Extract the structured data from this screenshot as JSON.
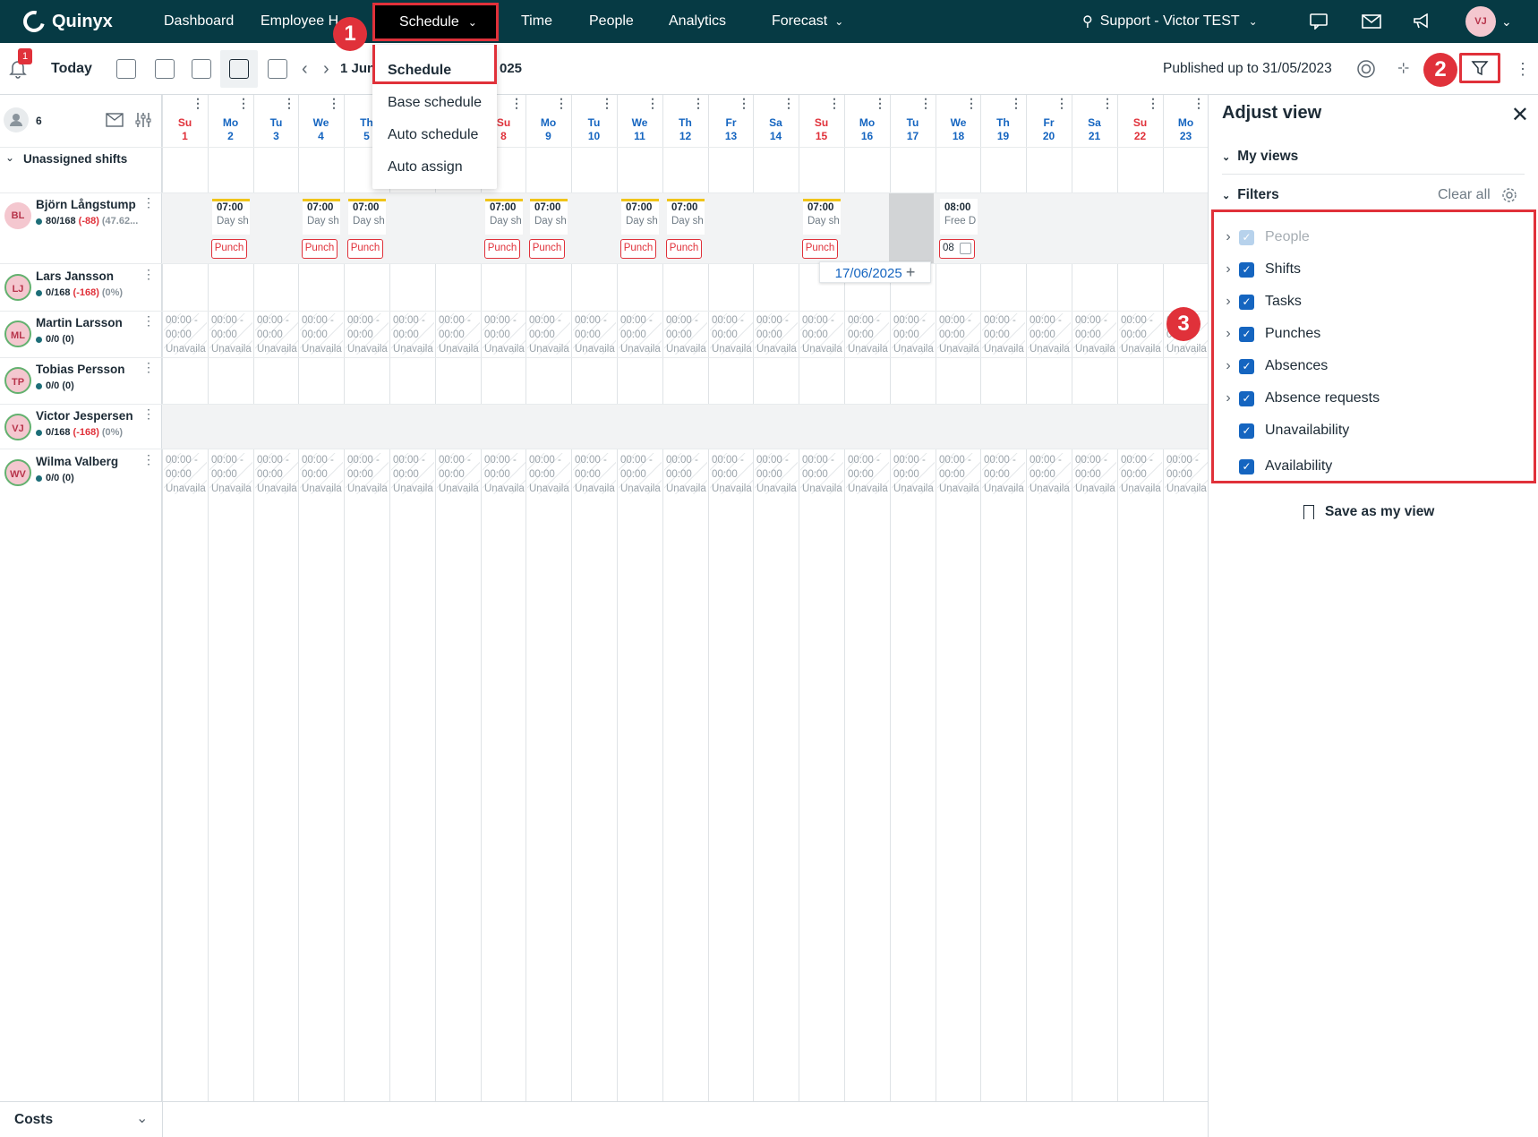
{
  "nav": {
    "brand": "Quinyx",
    "items": [
      "Dashboard",
      "Employee H",
      "Time",
      "People",
      "Analytics",
      "Forecast"
    ],
    "schedule": "Schedule",
    "unit": "Support - Victor TEST",
    "user_initials": "VJ"
  },
  "toolbar": {
    "notification_count": "1",
    "today": "Today",
    "date_range_prefix": "1 Jun",
    "date_range_suffix": "025",
    "published": "Published up to 31/05/2023"
  },
  "dropdown": [
    "Schedule",
    "Base schedule",
    "Auto schedule",
    "Auto assign"
  ],
  "callouts": [
    "1",
    "2",
    "3"
  ],
  "left": {
    "count": "6",
    "unassigned": "Unassigned shifts",
    "people": [
      {
        "initials": "BL",
        "name": "Björn Långstump",
        "stat": "80/168",
        "neg": "(-88)",
        "pct": "(47.62..."
      },
      {
        "initials": "LJ",
        "name": "Lars Jansson",
        "stat": "0/168",
        "neg": "(-168)",
        "pct": "(0%)"
      },
      {
        "initials": "ML",
        "name": "Martin Larsson",
        "stat": "0/0 (0)",
        "neg": "",
        "pct": ""
      },
      {
        "initials": "TP",
        "name": "Tobias Persson",
        "stat": "0/0 (0)",
        "neg": "",
        "pct": ""
      },
      {
        "initials": "VJ",
        "name": "Victor Jespersen",
        "stat": "0/168",
        "neg": "(-168)",
        "pct": "(0%)"
      },
      {
        "initials": "WV",
        "name": "Wilma Valberg",
        "stat": "0/0 (0)",
        "neg": "",
        "pct": ""
      }
    ]
  },
  "days": [
    {
      "d": "Su",
      "n": "1"
    },
    {
      "d": "Mo",
      "n": "2"
    },
    {
      "d": "Tu",
      "n": "3"
    },
    {
      "d": "We",
      "n": "4"
    },
    {
      "d": "Th",
      "n": "5"
    },
    {
      "d": "Fr",
      "n": "6"
    },
    {
      "d": "Sa",
      "n": "7"
    },
    {
      "d": "Su",
      "n": "8"
    },
    {
      "d": "Mo",
      "n": "9"
    },
    {
      "d": "Tu",
      "n": "10"
    },
    {
      "d": "We",
      "n": "11"
    },
    {
      "d": "Th",
      "n": "12"
    },
    {
      "d": "Fr",
      "n": "13"
    },
    {
      "d": "Sa",
      "n": "14"
    },
    {
      "d": "Su",
      "n": "15"
    },
    {
      "d": "Mo",
      "n": "16"
    },
    {
      "d": "Tu",
      "n": "17"
    },
    {
      "d": "We",
      "n": "18"
    },
    {
      "d": "Th",
      "n": "19"
    },
    {
      "d": "Fr",
      "n": "20"
    },
    {
      "d": "Sa",
      "n": "21"
    },
    {
      "d": "Su",
      "n": "22"
    },
    {
      "d": "Mo",
      "n": "23"
    }
  ],
  "shift": {
    "time": "07:00",
    "label": "Day sh",
    "punch": "Punch",
    "free_time": "08:00",
    "free_label": "Free D",
    "free_punch": "08"
  },
  "unavailable": {
    "line1": "00:00 -",
    "line2": "00:00",
    "line3": "Unavaila"
  },
  "date_badge": "17/06/2025",
  "panel": {
    "title": "Adjust view",
    "my_views": "My views",
    "filters": "Filters",
    "clear_all": "Clear all",
    "filter_items": [
      {
        "label": "People",
        "expandable": true,
        "disabled": true
      },
      {
        "label": "Shifts",
        "expandable": true,
        "disabled": false
      },
      {
        "label": "Tasks",
        "expandable": true,
        "disabled": false
      },
      {
        "label": "Punches",
        "expandable": true,
        "disabled": false
      },
      {
        "label": "Absences",
        "expandable": true,
        "disabled": false
      },
      {
        "label": "Absence requests",
        "expandable": true,
        "disabled": false
      },
      {
        "label": "Unavailability",
        "expandable": false,
        "disabled": false
      },
      {
        "label": "Availability",
        "expandable": false,
        "disabled": false
      }
    ],
    "save_view": "Save as my view"
  },
  "costs": "Costs",
  "colors": {
    "nav_bg": "#063a44",
    "accent_red": "#e0313a",
    "checkbox_blue": "#1565c0",
    "shift_yellow": "#f0c419"
  }
}
